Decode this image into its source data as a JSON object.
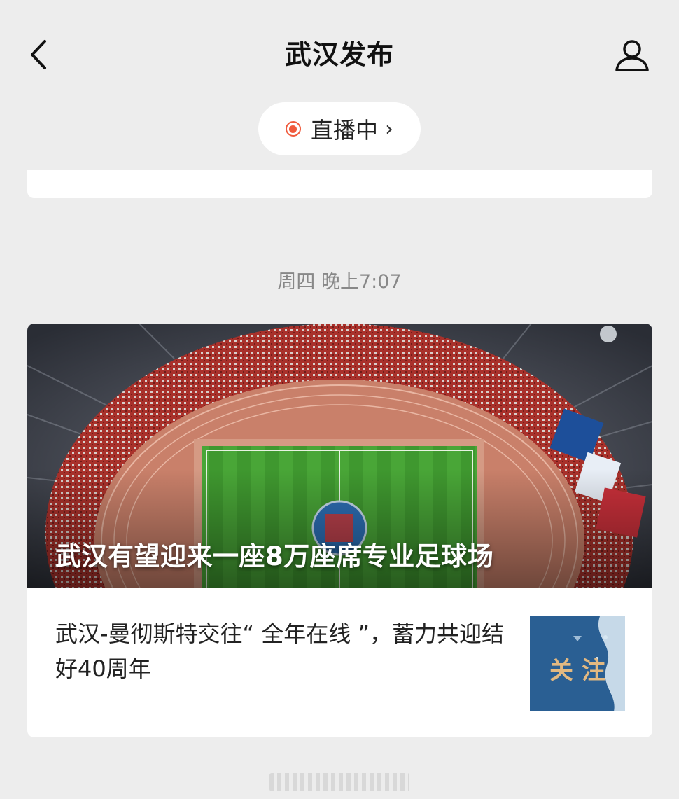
{
  "header": {
    "title": "武汉发布",
    "back_icon": "back-chevron-icon",
    "profile_icon": "person-icon"
  },
  "live": {
    "label": "直播中",
    "chevron": "›",
    "dot_color": "#f05a3c"
  },
  "timestamp": "周四 晚上7:07",
  "article": {
    "hero_title": "武汉有望迎来一座8万座席专业足球场",
    "sub_title": "武汉-曼彻斯特交往“ 全年在线 ”，蓄力共迎结好40周年",
    "thumb_text": "关注"
  },
  "colors": {
    "background": "#ededed",
    "card": "#ffffff",
    "accent_live": "#f05a3c"
  }
}
